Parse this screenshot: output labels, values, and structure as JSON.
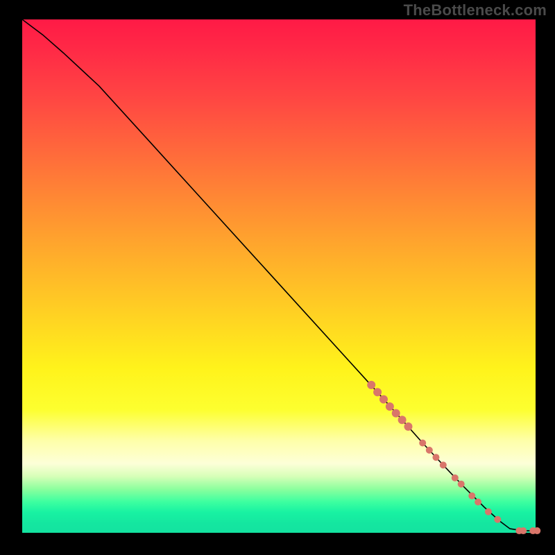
{
  "watermark": "TheBottleneck.com",
  "chart_data": {
    "type": "line",
    "title": "",
    "xlabel": "",
    "ylabel": "",
    "xlim": [
      0,
      100
    ],
    "ylim": [
      0,
      100
    ],
    "grid": false,
    "axes_visible": false,
    "background": "rainbow-vertical-gradient",
    "series": [
      {
        "name": "bottleneck-curve",
        "x": [
          0,
          4,
          8,
          15,
          25,
          35,
          45,
          55,
          65,
          70,
          74,
          78,
          82,
          86,
          90,
          93,
          95,
          97.5,
          100
        ],
        "y": [
          100,
          97,
          93.5,
          87,
          76,
          65,
          54,
          43,
          32,
          26.5,
          22,
          17.5,
          13.2,
          9,
          5,
          2.3,
          0.8,
          0.4,
          0.4
        ]
      }
    ],
    "markers": {
      "name": "highlighted-points",
      "color": "#d9766a",
      "points": [
        {
          "x": 68,
          "y": 28.8,
          "r": 6
        },
        {
          "x": 69.2,
          "y": 27.4,
          "r": 6
        },
        {
          "x": 70.4,
          "y": 26.0,
          "r": 6
        },
        {
          "x": 71.6,
          "y": 24.6,
          "r": 6
        },
        {
          "x": 72.8,
          "y": 23.3,
          "r": 6
        },
        {
          "x": 74,
          "y": 22.0,
          "r": 6
        },
        {
          "x": 75.2,
          "y": 20.7,
          "r": 6
        },
        {
          "x": 78,
          "y": 17.5,
          "r": 5
        },
        {
          "x": 79.3,
          "y": 16.1,
          "r": 5
        },
        {
          "x": 80.6,
          "y": 14.7,
          "r": 5
        },
        {
          "x": 82,
          "y": 13.2,
          "r": 5
        },
        {
          "x": 84.3,
          "y": 10.7,
          "r": 5
        },
        {
          "x": 85.5,
          "y": 9.5,
          "r": 5
        },
        {
          "x": 87.6,
          "y": 7.2,
          "r": 5
        },
        {
          "x": 88.8,
          "y": 6.0,
          "r": 5
        },
        {
          "x": 90.8,
          "y": 4.1,
          "r": 5
        },
        {
          "x": 92.6,
          "y": 2.6,
          "r": 5
        },
        {
          "x": 96.8,
          "y": 0.4,
          "r": 5
        },
        {
          "x": 97.6,
          "y": 0.4,
          "r": 5
        },
        {
          "x": 99.5,
          "y": 0.4,
          "r": 5
        },
        {
          "x": 100.3,
          "y": 0.4,
          "r": 5
        }
      ]
    }
  }
}
